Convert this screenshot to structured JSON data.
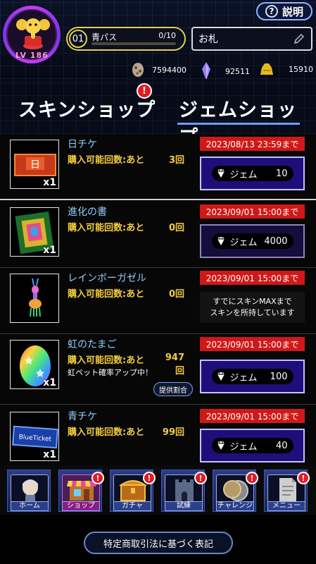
{
  "header": {
    "help_label": "説明",
    "level": "LV 186",
    "pass": {
      "number": "01",
      "name": "青パス",
      "count": "0/10",
      "progress": 0
    },
    "name_field_value": "お札",
    "currencies": [
      {
        "icon": "egg-currency-icon",
        "value": "7594400"
      },
      {
        "icon": "crystal-currency-icon",
        "value": "92511"
      },
      {
        "icon": "gold-currency-icon",
        "value": "15910"
      }
    ]
  },
  "tabs": [
    {
      "label": "スキンショップ",
      "active": false,
      "alert": "!"
    },
    {
      "label": "ジェムショップ",
      "active": true
    }
  ],
  "items": [
    {
      "title": "日チケ",
      "limit_label": "購入可能回数:あと",
      "limit_count": "3回",
      "deadline": "2023/08/13 23:59まで",
      "gem_label": "ジェム",
      "price": "10",
      "qty": "x1",
      "thumb_icon": "sun-ticket-icon"
    },
    {
      "title": "進化の書",
      "limit_label": "購入可能回数:あと",
      "limit_count": "0回",
      "deadline": "2023/09/01 15:00まで",
      "gem_label": "ジェム",
      "price": "4000",
      "qty": "x1",
      "thumb_icon": "evolution-book-icon"
    },
    {
      "title": "レインボーガゼル",
      "limit_label": "購入可能回数:あと",
      "limit_count": "0回",
      "deadline": "2023/09/01 15:00まで",
      "maxed_line1": "すでにスキンMAXまで",
      "maxed_line2": "スキンを所持しています",
      "thumb_icon": "rainbow-gazelle-icon"
    },
    {
      "title": "虹のたまご",
      "limit_label": "購入可能回数:あと",
      "limit_count": "947回",
      "deadline": "2023/09/01 15:00まで",
      "gem_label": "ジェム",
      "price": "100",
      "qty": "x1",
      "note": "虹ペット確率アップ中！",
      "rate_button": "提供割合",
      "thumb_icon": "rainbow-egg-icon"
    },
    {
      "title": "青チケ",
      "limit_label": "購入可能回数:あと",
      "limit_count": "99回",
      "deadline": "2023/09/01 15:00まで",
      "gem_label": "ジェム",
      "price": "40",
      "qty": "x1",
      "thumb_icon": "blue-ticket-icon",
      "thumb_text": "BlueTicket"
    }
  ],
  "nav": [
    {
      "label": "ホーム",
      "icon": "home-avatar-icon",
      "alert": ""
    },
    {
      "label": "ショップ",
      "icon": "shop-icon",
      "alert": "!"
    },
    {
      "label": "ガチャ",
      "icon": "gacha-chest-icon",
      "alert": "!"
    },
    {
      "label": "試練",
      "icon": "trial-tower-icon",
      "alert": "!"
    },
    {
      "label": "チャレンジ",
      "icon": "challenge-coin-icon",
      "alert": "!"
    },
    {
      "label": "メニュー",
      "icon": "menu-document-icon",
      "alert": "!"
    }
  ],
  "footer": {
    "law_label": "特定商取引法に基づく表記"
  },
  "colors": {
    "deadline_bg": "#d01818",
    "buy_bg": "#1f0e7a",
    "limit_text": "#f3cd3d",
    "title_text": "#8fd0ff",
    "accent": "#6aa0ff"
  }
}
